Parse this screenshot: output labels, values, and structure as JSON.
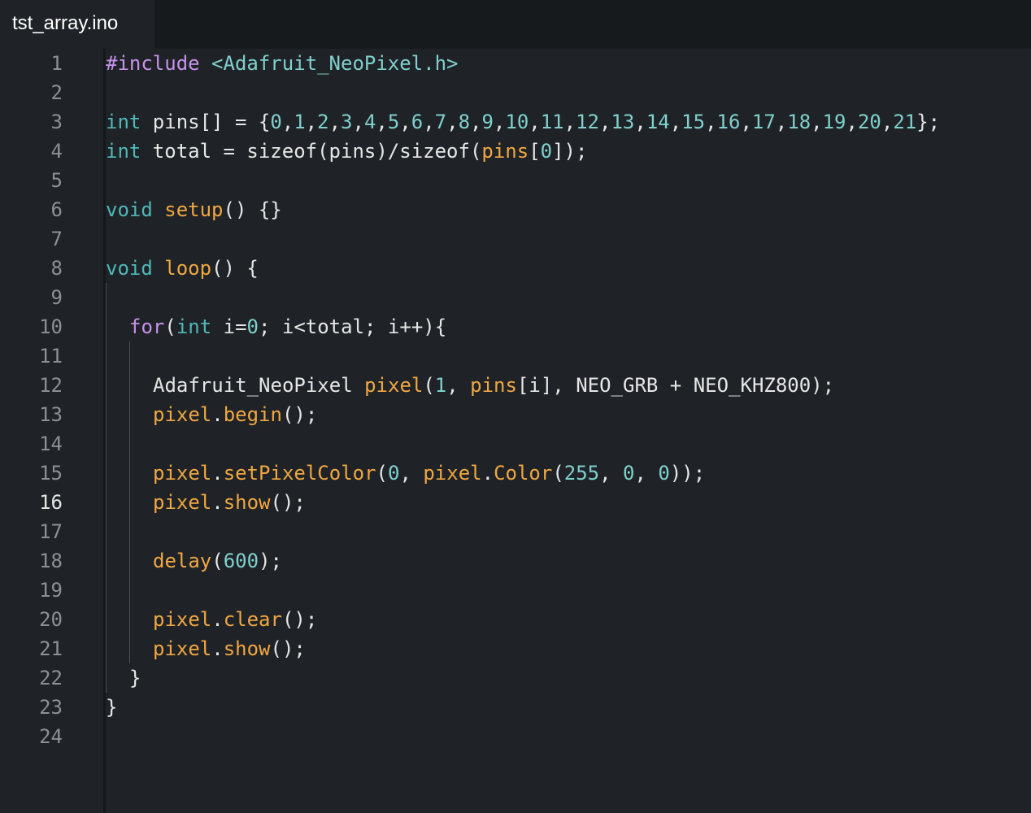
{
  "tab": {
    "title": "tst_array.ino"
  },
  "editor": {
    "active_line": 16,
    "lines": [
      {
        "n": "1",
        "indent": 0,
        "tokens": [
          {
            "t": "#include",
            "c": "kw"
          },
          {
            "t": " ",
            "c": "tx"
          },
          {
            "t": "<Adafruit_NeoPixel.h>",
            "c": "st"
          }
        ]
      },
      {
        "n": "2",
        "indent": 0,
        "tokens": []
      },
      {
        "n": "3",
        "indent": 0,
        "tokens": [
          {
            "t": "int",
            "c": "ty"
          },
          {
            "t": " pins[] = {",
            "c": "tx"
          },
          {
            "t": "0",
            "c": "nm"
          },
          {
            "t": ",",
            "c": "tx"
          },
          {
            "t": "1",
            "c": "nm"
          },
          {
            "t": ",",
            "c": "tx"
          },
          {
            "t": "2",
            "c": "nm"
          },
          {
            "t": ",",
            "c": "tx"
          },
          {
            "t": "3",
            "c": "nm"
          },
          {
            "t": ",",
            "c": "tx"
          },
          {
            "t": "4",
            "c": "nm"
          },
          {
            "t": ",",
            "c": "tx"
          },
          {
            "t": "5",
            "c": "nm"
          },
          {
            "t": ",",
            "c": "tx"
          },
          {
            "t": "6",
            "c": "nm"
          },
          {
            "t": ",",
            "c": "tx"
          },
          {
            "t": "7",
            "c": "nm"
          },
          {
            "t": ",",
            "c": "tx"
          },
          {
            "t": "8",
            "c": "nm"
          },
          {
            "t": ",",
            "c": "tx"
          },
          {
            "t": "9",
            "c": "nm"
          },
          {
            "t": ",",
            "c": "tx"
          },
          {
            "t": "10",
            "c": "nm"
          },
          {
            "t": ",",
            "c": "tx"
          },
          {
            "t": "11",
            "c": "nm"
          },
          {
            "t": ",",
            "c": "tx"
          },
          {
            "t": "12",
            "c": "nm"
          },
          {
            "t": ",",
            "c": "tx"
          },
          {
            "t": "13",
            "c": "nm"
          },
          {
            "t": ",",
            "c": "tx"
          },
          {
            "t": "14",
            "c": "nm"
          },
          {
            "t": ",",
            "c": "tx"
          },
          {
            "t": "15",
            "c": "nm"
          },
          {
            "t": ",",
            "c": "tx"
          },
          {
            "t": "16",
            "c": "nm"
          },
          {
            "t": ",",
            "c": "tx"
          },
          {
            "t": "17",
            "c": "nm"
          },
          {
            "t": ",",
            "c": "tx"
          },
          {
            "t": "18",
            "c": "nm"
          },
          {
            "t": ",",
            "c": "tx"
          },
          {
            "t": "19",
            "c": "nm"
          },
          {
            "t": ",",
            "c": "tx"
          },
          {
            "t": "20",
            "c": "nm"
          },
          {
            "t": ",",
            "c": "tx"
          },
          {
            "t": "21",
            "c": "nm"
          },
          {
            "t": "};",
            "c": "tx"
          }
        ]
      },
      {
        "n": "4",
        "indent": 0,
        "tokens": [
          {
            "t": "int",
            "c": "ty"
          },
          {
            "t": " total = sizeof(pins)/sizeof(",
            "c": "tx"
          },
          {
            "t": "pins",
            "c": "fn"
          },
          {
            "t": "[",
            "c": "tx"
          },
          {
            "t": "0",
            "c": "nm"
          },
          {
            "t": "]);",
            "c": "tx"
          }
        ]
      },
      {
        "n": "5",
        "indent": 0,
        "tokens": []
      },
      {
        "n": "6",
        "indent": 0,
        "tokens": [
          {
            "t": "void",
            "c": "ty"
          },
          {
            "t": " ",
            "c": "tx"
          },
          {
            "t": "setup",
            "c": "fn"
          },
          {
            "t": "() {}",
            "c": "tx"
          }
        ]
      },
      {
        "n": "7",
        "indent": 0,
        "tokens": []
      },
      {
        "n": "8",
        "indent": 0,
        "tokens": [
          {
            "t": "void",
            "c": "ty"
          },
          {
            "t": " ",
            "c": "tx"
          },
          {
            "t": "loop",
            "c": "fn"
          },
          {
            "t": "() {",
            "c": "tx"
          }
        ]
      },
      {
        "n": "9",
        "indent": 0,
        "tokens": []
      },
      {
        "n": "10",
        "indent": 1,
        "tokens": [
          {
            "t": "for",
            "c": "kw"
          },
          {
            "t": "(",
            "c": "tx"
          },
          {
            "t": "int",
            "c": "ty"
          },
          {
            "t": " i=",
            "c": "tx"
          },
          {
            "t": "0",
            "c": "nm"
          },
          {
            "t": "; i<total; i++){",
            "c": "tx"
          }
        ]
      },
      {
        "n": "11",
        "indent": 0,
        "tokens": []
      },
      {
        "n": "12",
        "indent": 2,
        "tokens": [
          {
            "t": "Adafruit_NeoPixel ",
            "c": "tx"
          },
          {
            "t": "pixel",
            "c": "fn"
          },
          {
            "t": "(",
            "c": "tx"
          },
          {
            "t": "1",
            "c": "nm"
          },
          {
            "t": ", ",
            "c": "tx"
          },
          {
            "t": "pins",
            "c": "fn"
          },
          {
            "t": "[i], NEO_GRB + NEO_KHZ800);",
            "c": "tx"
          }
        ]
      },
      {
        "n": "13",
        "indent": 2,
        "tokens": [
          {
            "t": "pixel",
            "c": "fn"
          },
          {
            "t": ".",
            "c": "tx"
          },
          {
            "t": "begin",
            "c": "fn"
          },
          {
            "t": "();",
            "c": "tx"
          }
        ]
      },
      {
        "n": "14",
        "indent": 0,
        "tokens": []
      },
      {
        "n": "15",
        "indent": 2,
        "tokens": [
          {
            "t": "pixel",
            "c": "fn"
          },
          {
            "t": ".",
            "c": "tx"
          },
          {
            "t": "setPixelColor",
            "c": "fn"
          },
          {
            "t": "(",
            "c": "tx"
          },
          {
            "t": "0",
            "c": "nm"
          },
          {
            "t": ", ",
            "c": "tx"
          },
          {
            "t": "pixel",
            "c": "fn"
          },
          {
            "t": ".",
            "c": "tx"
          },
          {
            "t": "Color",
            "c": "fn"
          },
          {
            "t": "(",
            "c": "tx"
          },
          {
            "t": "255",
            "c": "nm"
          },
          {
            "t": ", ",
            "c": "tx"
          },
          {
            "t": "0",
            "c": "nm"
          },
          {
            "t": ", ",
            "c": "tx"
          },
          {
            "t": "0",
            "c": "nm"
          },
          {
            "t": "));",
            "c": "tx"
          }
        ]
      },
      {
        "n": "16",
        "indent": 2,
        "tokens": [
          {
            "t": "pixel",
            "c": "fn"
          },
          {
            "t": ".",
            "c": "tx"
          },
          {
            "t": "show",
            "c": "fn"
          },
          {
            "t": "();",
            "c": "tx"
          }
        ]
      },
      {
        "n": "17",
        "indent": 0,
        "tokens": []
      },
      {
        "n": "18",
        "indent": 2,
        "tokens": [
          {
            "t": "delay",
            "c": "fn"
          },
          {
            "t": "(",
            "c": "tx"
          },
          {
            "t": "600",
            "c": "nm"
          },
          {
            "t": ");",
            "c": "tx"
          }
        ]
      },
      {
        "n": "19",
        "indent": 0,
        "tokens": []
      },
      {
        "n": "20",
        "indent": 2,
        "tokens": [
          {
            "t": "pixel",
            "c": "fn"
          },
          {
            "t": ".",
            "c": "tx"
          },
          {
            "t": "clear",
            "c": "fn"
          },
          {
            "t": "();",
            "c": "tx"
          }
        ]
      },
      {
        "n": "21",
        "indent": 2,
        "tokens": [
          {
            "t": "pixel",
            "c": "fn"
          },
          {
            "t": ".",
            "c": "tx"
          },
          {
            "t": "show",
            "c": "fn"
          },
          {
            "t": "();",
            "c": "tx"
          }
        ]
      },
      {
        "n": "22",
        "indent": 1,
        "tokens": [
          {
            "t": "}",
            "c": "tx"
          }
        ]
      },
      {
        "n": "23",
        "indent": 0,
        "tokens": [
          {
            "t": "}",
            "c": "tx"
          }
        ]
      },
      {
        "n": "24",
        "indent": 0,
        "tokens": []
      }
    ]
  },
  "colors": {
    "background": "#1f2327",
    "tabbar": "#171a1d",
    "keyword": "#c792ea",
    "type": "#4fb8b8",
    "function": "#f0a741",
    "number": "#7fd0cc",
    "text": "#e6e6e6",
    "line_number": "#8b9095"
  }
}
